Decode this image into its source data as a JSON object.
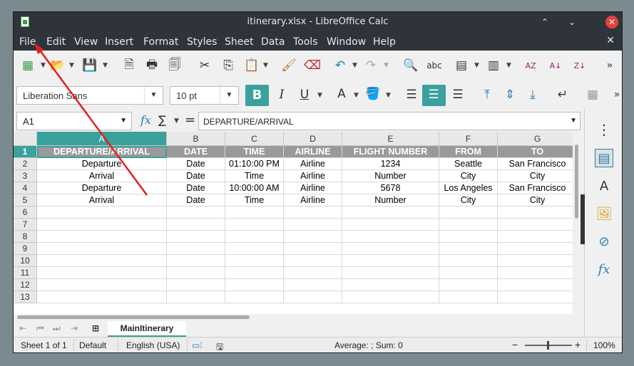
{
  "window": {
    "title": "itinerary.xlsx - LibreOffice Calc",
    "minimize": "⌃",
    "maximize": "⌄",
    "close": "✕"
  },
  "menu": [
    {
      "label": "File"
    },
    {
      "label": "Edit"
    },
    {
      "label": "View"
    },
    {
      "label": "Insert"
    },
    {
      "label": "Format"
    },
    {
      "label": "Styles"
    },
    {
      "label": "Sheet"
    },
    {
      "label": "Data"
    },
    {
      "label": "Tools"
    },
    {
      "label": "Window"
    },
    {
      "label": "Help"
    }
  ],
  "doc_close": "✕",
  "format_bar": {
    "font_name": "Liberation Sans",
    "font_size": "10 pt",
    "bold": "B",
    "italic": "I",
    "underline": "U",
    "font_color": "A"
  },
  "formula_bar": {
    "name_box": "A1",
    "content": "DEPARTURE/ARRIVAL",
    "fx": "fx",
    "sigma": "∑",
    "equals": "="
  },
  "columns": [
    {
      "label": "A"
    },
    {
      "label": "B"
    },
    {
      "label": "C"
    },
    {
      "label": "D"
    },
    {
      "label": "E"
    },
    {
      "label": "F"
    },
    {
      "label": "G"
    }
  ],
  "rows": [
    "1",
    "2",
    "3",
    "4",
    "5",
    "6",
    "7",
    "8",
    "9",
    "10",
    "11",
    "12",
    "13"
  ],
  "cells": [
    [
      "DEPARTURE/ARRIVAL",
      "DATE",
      "TIME",
      "AIRLINE",
      "FLIGHT NUMBER",
      "FROM",
      "TO"
    ],
    [
      "Departure",
      "Date",
      "01:10:00 PM",
      "Airline",
      "1234",
      "Seattle",
      "San Francisco"
    ],
    [
      "Arrival",
      "Date",
      "Time",
      "Airline",
      "Number",
      "City",
      "City"
    ],
    [
      "Departure",
      "Date",
      "10:00:00 AM",
      "Airline",
      "5678",
      "Los Angeles",
      "San Francisco"
    ],
    [
      "Arrival",
      "Date",
      "Time",
      "Airline",
      "Number",
      "City",
      "City"
    ]
  ],
  "sheet_tab": "MainItinerary",
  "status": {
    "sheet": "Sheet 1 of 1",
    "style": "Default",
    "language": "English (USA)",
    "summary": "Average: ; Sum: 0",
    "zoom_minus": "−",
    "zoom_plus": "+",
    "zoom": "100%"
  },
  "colors": {
    "accent": "#3aa19c",
    "titlebar": "#2f343a",
    "header_fill": "#9a9a9a",
    "arrow": "#e02020"
  }
}
